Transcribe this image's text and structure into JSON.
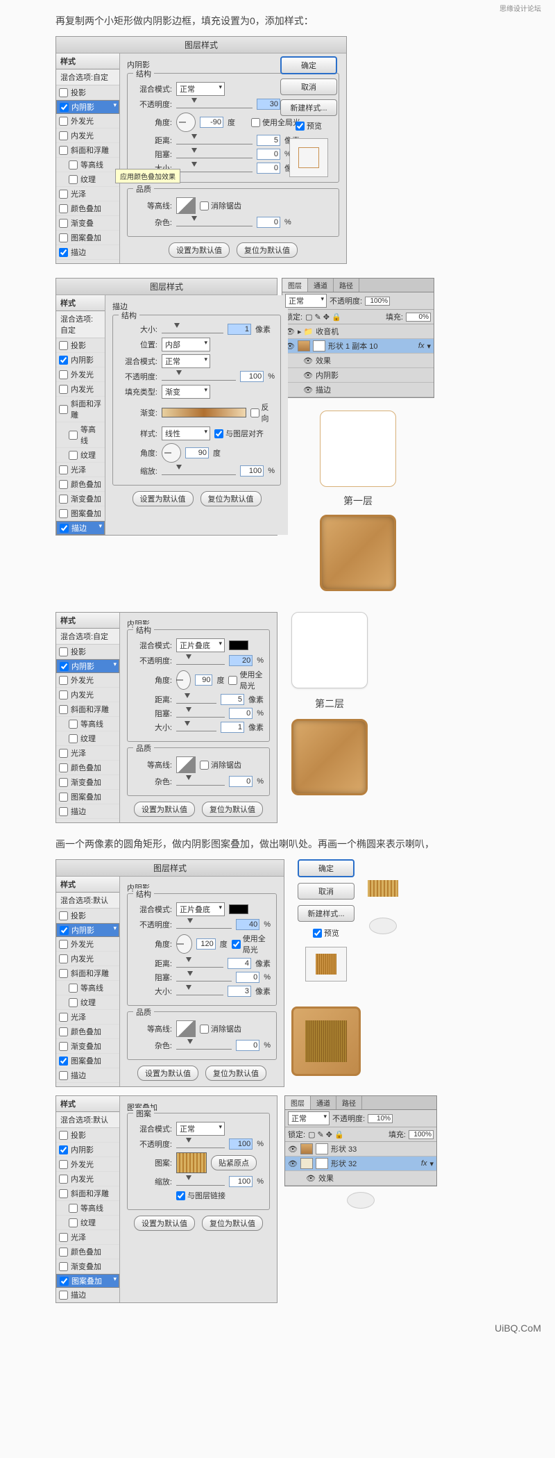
{
  "watermark": "思缘设计论坛",
  "intro1": "再复制两个小矩形做内阴影边框，填充设置为0，添加样式：",
  "intro2": "画一个两像素的圆角矩形，做内阴影图案叠加，做出喇叭处。再画一个椭圆来表示喇叭，",
  "dlg_title": "图层样式",
  "styles": {
    "header": "样式",
    "blend_custom": "混合选项:自定",
    "blend_default": "混合选项:默认",
    "items": {
      "drop": "投影",
      "inner": "内阴影",
      "outerglow": "外发光",
      "innerglow": "内发光",
      "bevel": "斜面和浮雕",
      "contour": "等高线",
      "texture": "纹理",
      "satin": "光泽",
      "color": "颜色叠加",
      "grad": "渐变叠加",
      "pat": "图案叠加",
      "stroke": "描边"
    }
  },
  "tooltip": "应用颜色叠加效果",
  "labels": {
    "innerShadow": "内阴影",
    "struct": "结构",
    "blendMode": "混合模式:",
    "opacity": "不透明度:",
    "angle": "角度:",
    "deg": "度",
    "useGlobal": "使用全局光",
    "distance": "距离:",
    "choke": "阻塞:",
    "size": "大小:",
    "px": "像素",
    "quality": "品质",
    "contour": "等高线:",
    "antialias": "消除锯齿",
    "noise": "杂色:",
    "setDefault": "设置为默认值",
    "reset": "复位为默认值",
    "stroke": "描边",
    "position": "位置:",
    "fillType": "填充类型:",
    "gradient": "渐变:",
    "reverse": "反向",
    "style": "样式:",
    "alignLayer": "与图层对齐",
    "scale": "缩放:",
    "patOverlay": "图案叠加",
    "pattern": "图案:",
    "snap": "贴紧原点",
    "linkLayer": "与图层链接"
  },
  "values": {
    "normal": "正常",
    "multiply": "正片叠底",
    "inside": "内部",
    "linear": "线性",
    "p1": {
      "op": "30",
      "angle": "-90",
      "dist": "5",
      "choke": "0",
      "size": "0",
      "noise": "0"
    },
    "p2": {
      "size": "1",
      "op": "100",
      "angle": "90",
      "scale": "100"
    },
    "p3": {
      "op": "20",
      "angle": "90",
      "dist": "5",
      "choke": "0",
      "size": "1",
      "noise": "0"
    },
    "p4": {
      "op": "40",
      "angle": "120",
      "dist": "4",
      "choke": "0",
      "size": "3",
      "noise": "0"
    },
    "p5": {
      "op": "100",
      "scale": "100"
    }
  },
  "buttons": {
    "ok": "确定",
    "cancel": "取消",
    "newStyle": "新建样式...",
    "preview": "预览"
  },
  "layers": {
    "tabs": {
      "layer": "图层",
      "channel": "通道",
      "path": "路径"
    },
    "normal": "正常",
    "opacity": "不透明度:",
    "lock": "锁定:",
    "fill": "填充:",
    "op100": "100%",
    "op10": "10%",
    "fill0": "0%",
    "fill100": "100%",
    "radio": "收音机",
    "shape10": "形状 1 副本 10",
    "fx": "fx",
    "effects": "效果",
    "inner": "内阴影",
    "stroke": "描边",
    "shape33": "形状 33",
    "shape32": "形状 32"
  },
  "preview": {
    "layer1": "第一层",
    "layer2": "第二层"
  }
}
